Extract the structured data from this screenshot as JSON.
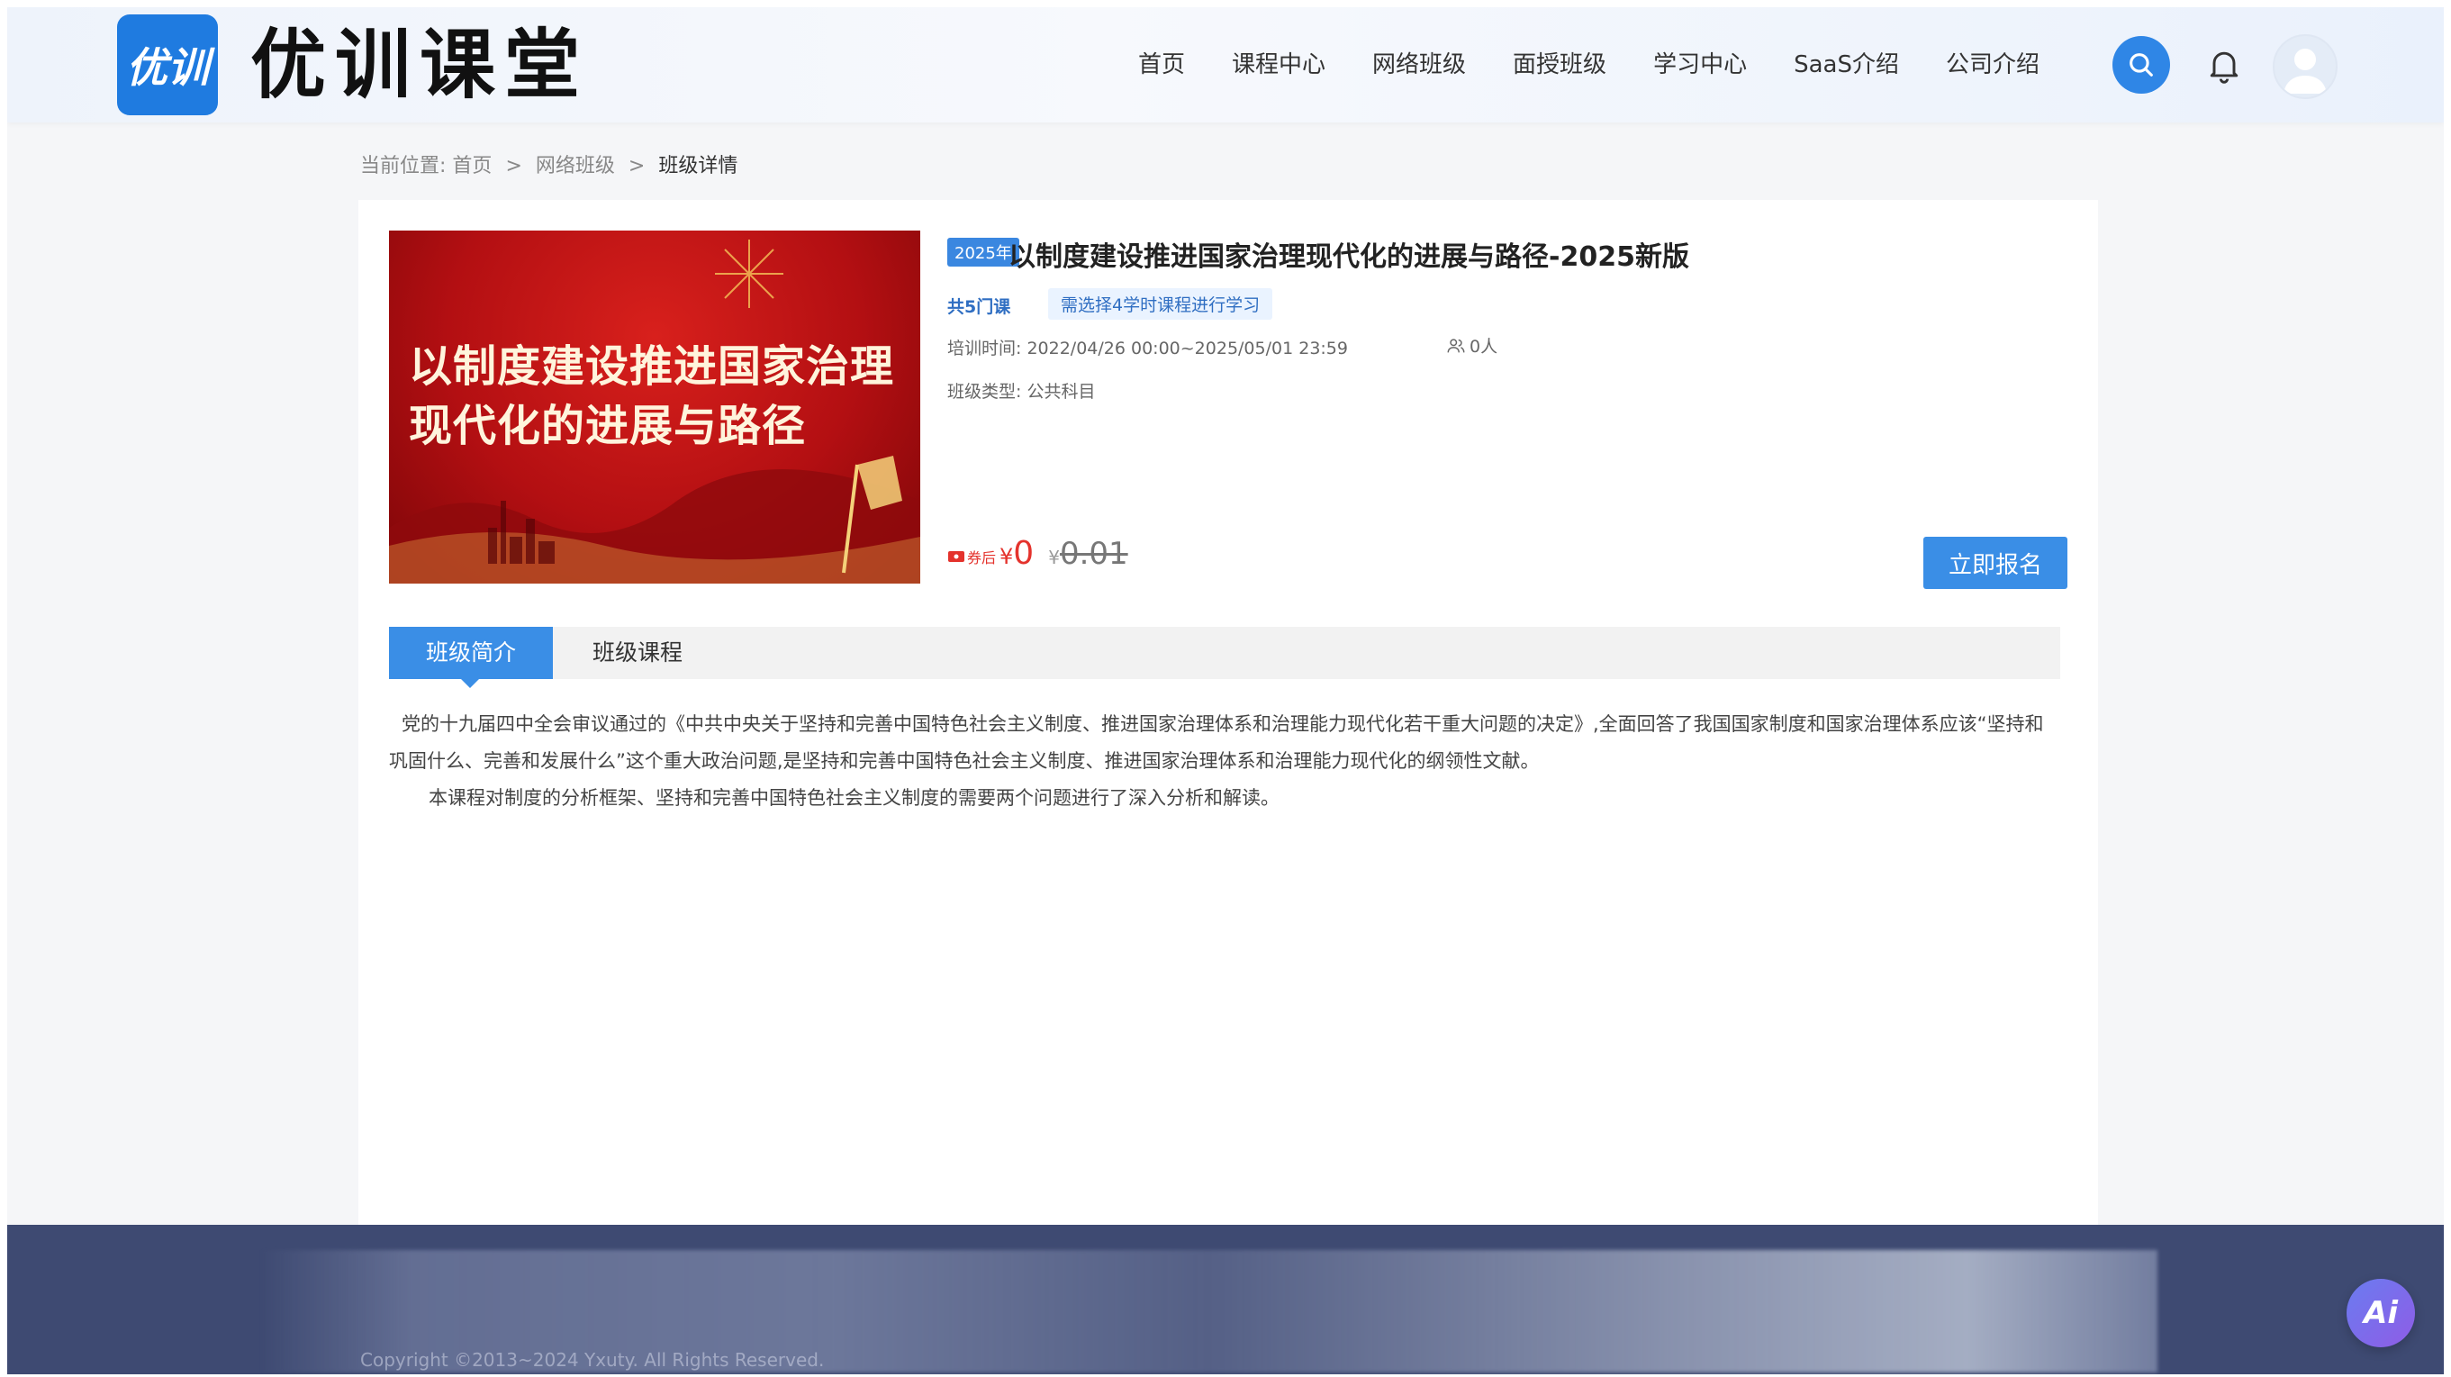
{
  "brand": {
    "logo_mark": "优训",
    "name": "优训课堂"
  },
  "nav": {
    "items": [
      "首页",
      "课程中心",
      "网络班级",
      "面授班级",
      "学习中心",
      "SaaS介绍",
      "公司介绍"
    ]
  },
  "breadcrumb": {
    "prefix": "当前位置:",
    "items": [
      "首页",
      "网络班级",
      "班级详情"
    ],
    "separator": ">"
  },
  "class": {
    "cover_text": "以制度建设推进国家治理现代化的进展与路径",
    "year_badge": "2025年",
    "title": "以制度建设推进国家治理现代化的进展与路径-2025新版",
    "course_count": "共5门课",
    "requirement": "需选择4学时课程进行学习",
    "training_time_label": "培训时间:",
    "training_time": "2022/04/26 00:00~2025/05/01 23:59",
    "enrolled": "0人",
    "type_label": "班级类型:",
    "type": "公共科目",
    "coupon_label": "券后",
    "currency": "¥",
    "price_now": "0",
    "price_old": "0.01",
    "enroll_button": "立即报名"
  },
  "tabs": {
    "items": [
      "班级简介",
      "班级课程"
    ],
    "active": 0
  },
  "description": {
    "p1": "党的十九届四中全会审议通过的《中共中央关于坚持和完善中国特色社会主义制度、推进国家治理体系和治理能力现代化若干重大问题的决定》,全面回答了我国国家制度和国家治理体系应该“坚持和巩固什么、完善和发展什么”这个重大政治问题,是坚持和完善中国特色社会主义制度、推进国家治理体系和治理能力现代化的纲领性文献。",
    "p2": "本课程对制度的分析框架、坚持和完善中国特色社会主义制度的需要两个问题进行了深入分析和解读。"
  },
  "footer": {
    "copyright": "Copyright ©2013~2024 Yxuty. All Rights Reserved."
  },
  "ai_button": "Ai",
  "colors": {
    "primary": "#3a8ee6",
    "price_red": "#e4322c",
    "footer_bg": "#3e4a72"
  },
  "icons": {
    "search": "search-icon",
    "bell": "bell-icon",
    "user": "user-icon",
    "people": "people-icon",
    "coupon": "coupon-icon"
  }
}
